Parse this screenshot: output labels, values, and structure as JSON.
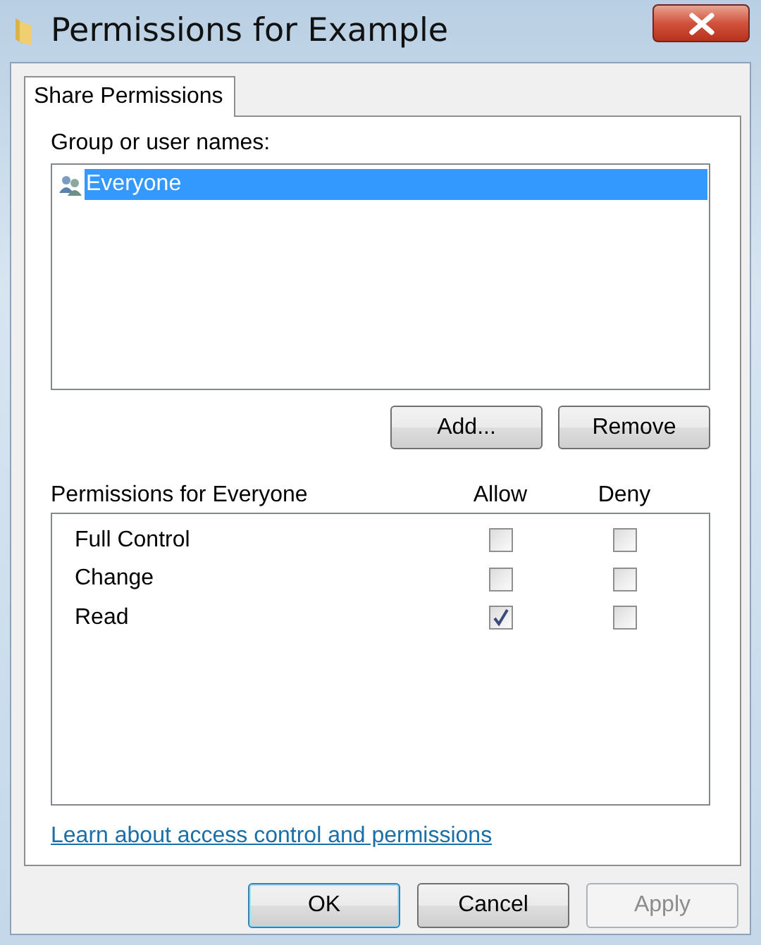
{
  "window": {
    "title": "Permissions for Example"
  },
  "tabs": [
    {
      "label": "Share Permissions",
      "selected": true
    }
  ],
  "group_label": "Group or user names:",
  "users": [
    {
      "name": "Everyone",
      "selected": true
    }
  ],
  "user_buttons": [
    {
      "label": "Add...",
      "disabled": false
    },
    {
      "label": "Remove",
      "disabled": false
    }
  ],
  "permissions": {
    "title": "Permissions for Everyone",
    "columns": [
      "Allow",
      "Deny"
    ],
    "rows": [
      {
        "name": "Full Control",
        "allow": false,
        "deny": false
      },
      {
        "name": "Change",
        "allow": false,
        "deny": false
      },
      {
        "name": "Read",
        "allow": true,
        "deny": false
      }
    ]
  },
  "link": "Learn about access control and permissions",
  "buttons": [
    {
      "label": "OK",
      "default": true,
      "disabled": false
    },
    {
      "label": "Cancel",
      "default": false,
      "disabled": false
    },
    {
      "label": "Apply",
      "default": false,
      "disabled": true
    }
  ]
}
